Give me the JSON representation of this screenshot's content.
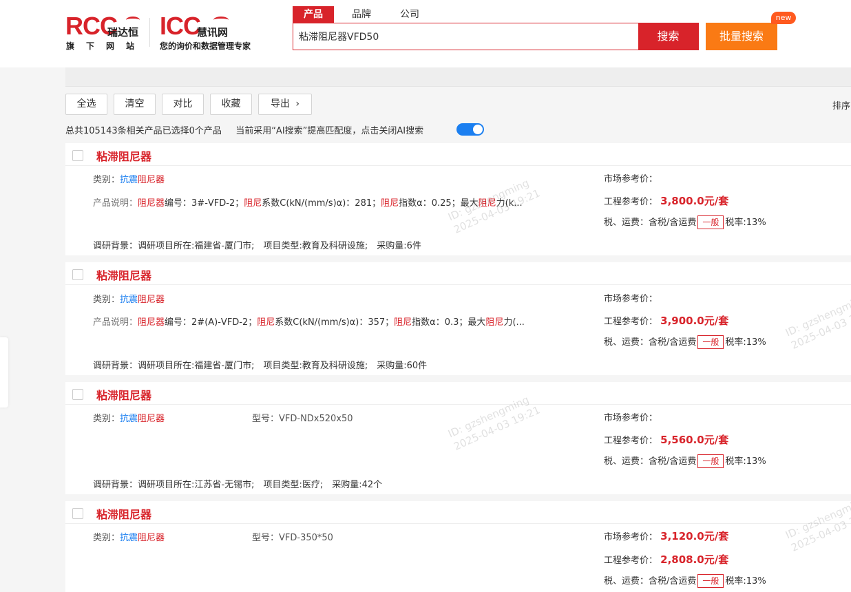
{
  "header": {
    "rcc_logo": "RCC",
    "rcc_cn": "瑞达恒",
    "rcc_sub": "旗下网站",
    "icc_logo": "ICC",
    "icc_cn": "慧讯网",
    "icc_sub": "您的询价和数据管理专家",
    "tabs": [
      "产品",
      "品牌",
      "公司"
    ],
    "search_value": "粘滞阻尼器VFD50",
    "search_button": "搜索",
    "batch_button": "批量搜索",
    "new_badge": "new"
  },
  "toolbar": {
    "select_all": "全选",
    "clear": "清空",
    "compare": "对比",
    "favorite": "收藏",
    "export": "导出",
    "sort": "排序"
  },
  "summary": {
    "count_text": "总共105143条相关产品已选择0个产品",
    "ai_text": "当前采用“AI搜索”提高匹配度，点击关闭AI搜索",
    "ai_enabled": true
  },
  "watermark": {
    "id": "ID: gzshengming",
    "time": "2025-04-03 19:21"
  },
  "products": [
    {
      "title": "粘滞阻尼器",
      "category_label": "类别：",
      "category_a": "抗震",
      "category_b": "阻尼器",
      "desc_label": "产品说明：",
      "desc_parts": [
        "阻尼器",
        "编号：3#-VFD-2；",
        "阻尼",
        "系数C(kN/(mm/s)α)：281；",
        "阻尼",
        "指数α：0.25；最大",
        "阻尼",
        "力(k..."
      ],
      "model": "",
      "background": "调研背景：调研项目所在:福建省-厦门市;　项目类型:教育及科研设施;　采购量:6件",
      "market_label": "市场参考价：",
      "market_price": "",
      "eng_label": "工程参考价：",
      "eng_price": "3,800.0元/套",
      "tax_label": "税、运费：含税/含运费",
      "tag": "一般",
      "tax_rate": "税率:13%"
    },
    {
      "title": "粘滞阻尼器",
      "category_label": "类别：",
      "category_a": "抗震",
      "category_b": "阻尼器",
      "desc_label": "产品说明：",
      "desc_parts": [
        "阻尼器",
        "编号：2#(A)-VFD-2；",
        "阻尼",
        "系数C(kN/(mm/s)α)：357；",
        "阻尼",
        "指数α：0.3；最大",
        "阻尼",
        "力(..."
      ],
      "model": "",
      "background": "调研背景：调研项目所在:福建省-厦门市;　项目类型:教育及科研设施;　采购量:60件",
      "market_label": "市场参考价：",
      "market_price": "",
      "eng_label": "工程参考价：",
      "eng_price": "3,900.0元/套",
      "tax_label": "税、运费：含税/含运费",
      "tag": "一般",
      "tax_rate": "税率:13%"
    },
    {
      "title": "粘滞阻尼器",
      "category_label": "类别：",
      "category_a": "抗震",
      "category_b": "阻尼器",
      "model": "型号：VFD-NDx520x50",
      "background": "调研背景：调研项目所在:江苏省-无锡市;　项目类型:医疗;　采购量:42个",
      "market_label": "市场参考价：",
      "market_price": "",
      "eng_label": "工程参考价：",
      "eng_price": "5,560.0元/套",
      "tax_label": "税、运费：含税/含运费",
      "tag": "一般",
      "tax_rate": "税率:13%"
    },
    {
      "title": "粘滞阻尼器",
      "category_label": "类别：",
      "category_a": "抗震",
      "category_b": "阻尼器",
      "model": "型号：VFD-350*50",
      "background": "",
      "market_label": "市场参考价：",
      "market_price": "3,120.0元/套",
      "eng_label": "工程参考价：",
      "eng_price": "2,808.0元/套",
      "tax_label": "税、运费：含税/含运费",
      "tag": "一般",
      "tax_rate": "税率:13%"
    }
  ]
}
